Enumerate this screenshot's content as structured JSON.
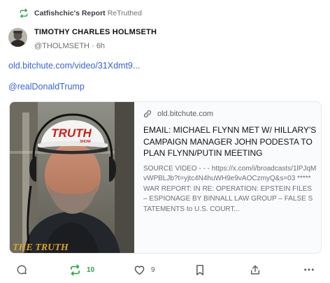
{
  "retruth": {
    "account": "Catfishchic's Report",
    "tag": "ReTruthed"
  },
  "author": {
    "display_name": "TIMOTHY CHARLES HOLMSETH",
    "handle": "@THOLMSETH",
    "separator": "·",
    "time": "6h"
  },
  "post": {
    "link": "old.bitchute.com/video/31Xdmt9...",
    "mention": "@realDonaldTrump"
  },
  "card": {
    "domain": "old.bitchute.com",
    "title": "EMAIL: MICHAEL FLYNN MET W/ HILLARY'S CAMPAIGN MANAGER JOHN PODESTA TO PLAN FLYNN/PUTIN MEETING",
    "description": "SOURCE VIDEO - - - https://x.com/i/broadcasts/1lPJqMvWPBLJb?t=yjtc4N4huWH9e9vAOCzmyQ&s=03 ***** WAR REPORT: IN RE: OPERATION: EPSTEIN FILES – ESPIONAGE BY BINNALL LAW GROUP – FALSE STATEMENTS to U.S. COURT...",
    "thumbnail_hat_text": "TRUTH",
    "thumbnail_hat_subtext": "SHOW",
    "thumbnail_corner_text": "THE TRUTH"
  },
  "actions": {
    "retruth_count": "10",
    "like_count": "9"
  },
  "colors": {
    "link": "#3a63d6",
    "retruth_green": "#2aa147"
  },
  "icons": [
    "retruth-icon",
    "link-icon",
    "reply-icon",
    "heart-icon",
    "bookmark-icon",
    "share-icon",
    "more-icon"
  ]
}
